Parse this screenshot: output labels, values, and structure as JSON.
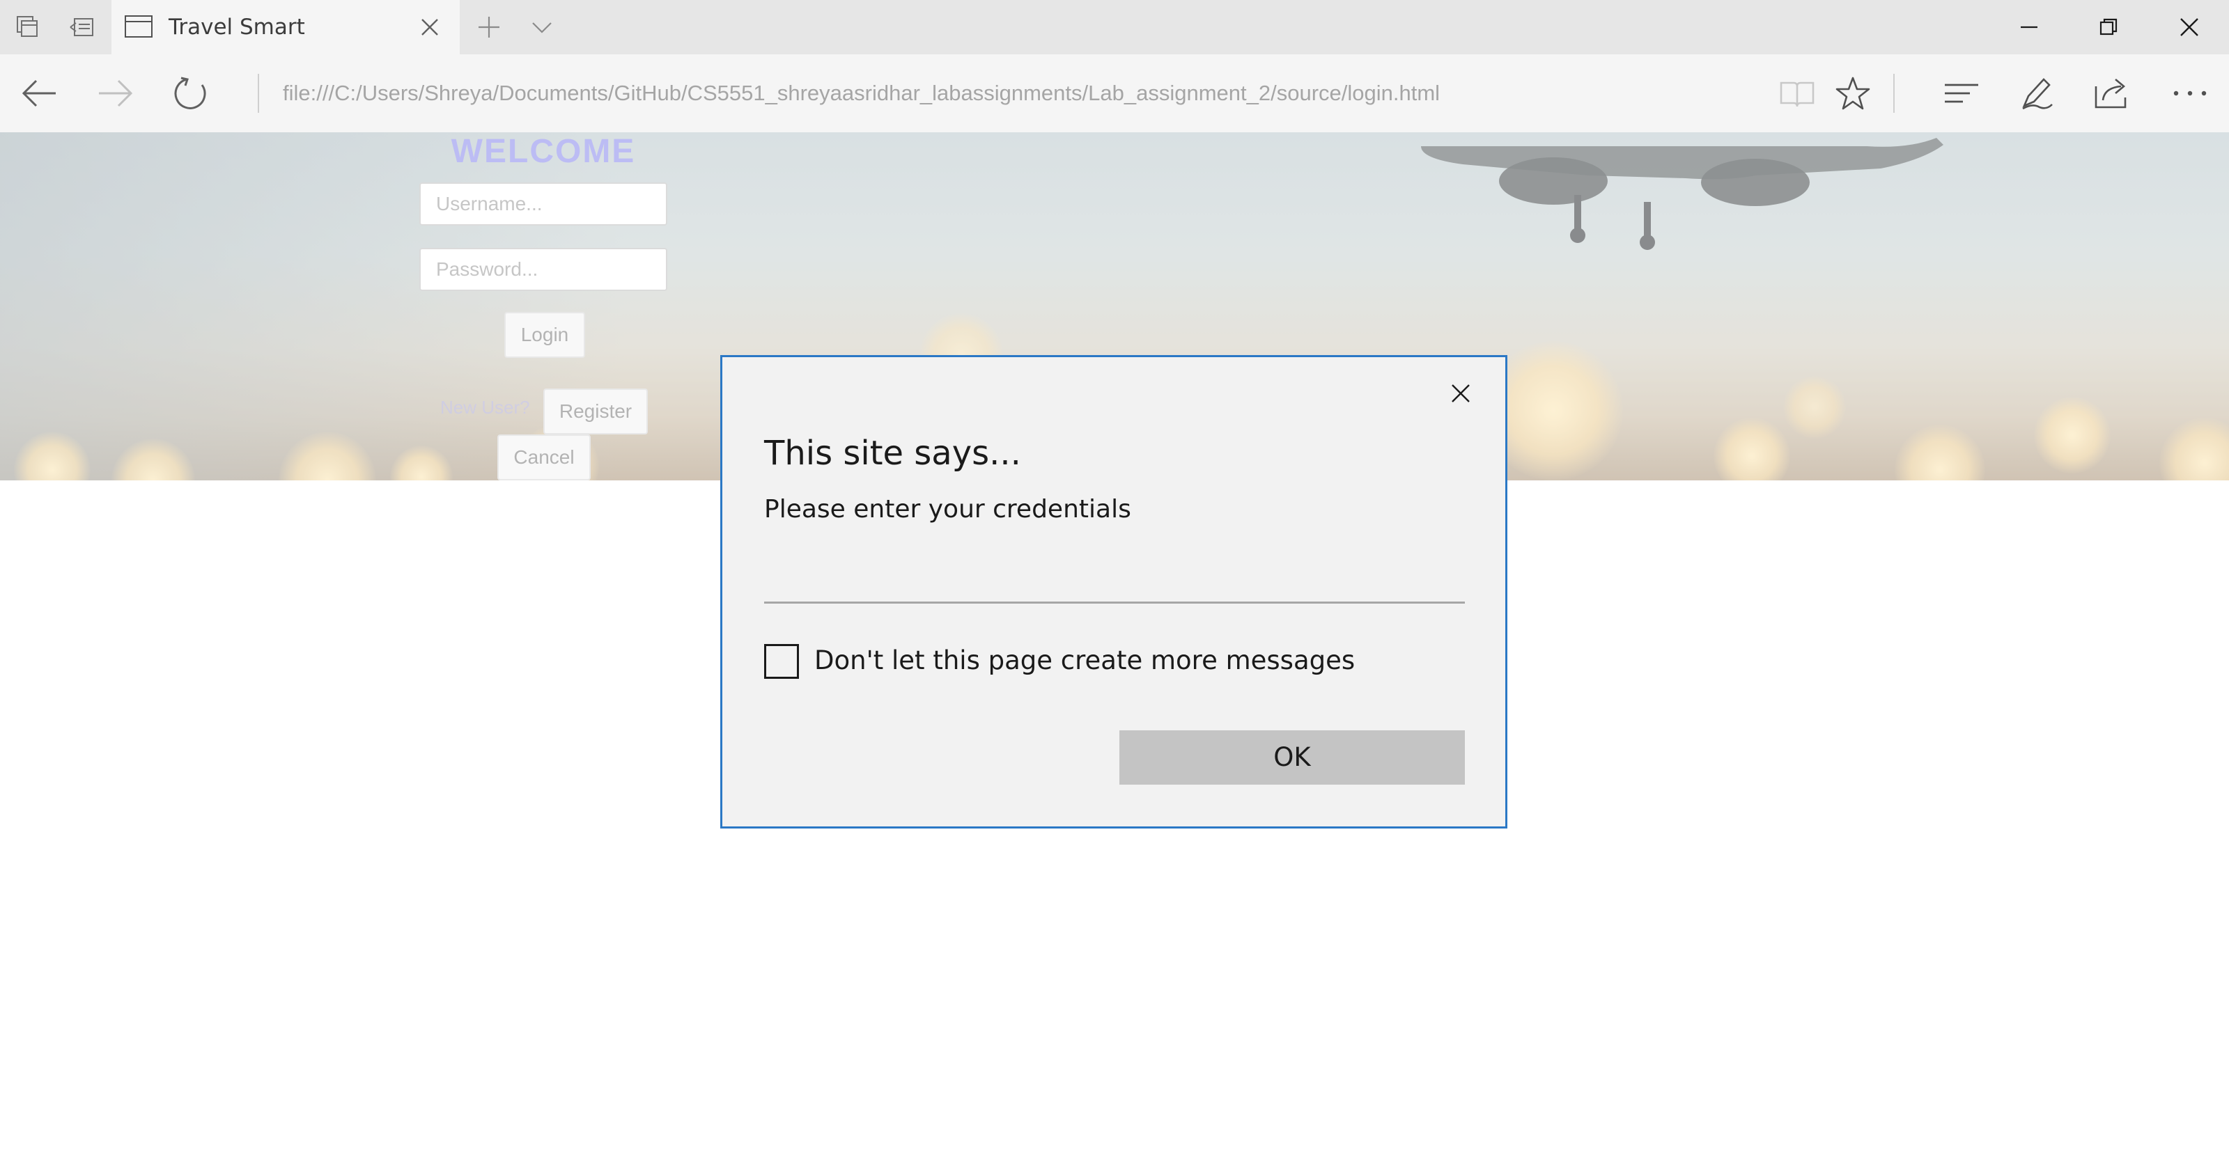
{
  "browser": {
    "tab": {
      "title": "Travel Smart"
    },
    "address_bar": {
      "url": "file:///C:/Users/Shreya/Documents/GitHub/CS5551_shreyaasridhar_labassignments/Lab_assignment_2/source/login.html"
    },
    "window_controls": [
      "minimize",
      "restore",
      "close"
    ]
  },
  "page": {
    "welcome": "WELCOME",
    "username_placeholder": "Username...",
    "password_placeholder": "Password...",
    "login_label": "Login",
    "new_user_label": "New User?",
    "register_label": "Register",
    "cancel_label": "Cancel"
  },
  "dialog": {
    "title": "This site says...",
    "message": "Please enter your credentials",
    "input_value": "",
    "checkbox_label": "Don't let this page create more messages",
    "checkbox_checked": false,
    "ok_label": "OK"
  },
  "colors": {
    "dialog_border": "#2b78c5",
    "welcome": "#9999ee",
    "ok_button": "#c4c4c4"
  },
  "icons": [
    "tab-manager-icon",
    "set-aside-tabs-icon",
    "tab-page-icon",
    "close-tab-icon",
    "new-tab-icon",
    "tab-list-chevron-icon",
    "back-arrow-icon",
    "forward-arrow-icon",
    "refresh-icon",
    "reading-view-icon",
    "favorite-star-icon",
    "hub-icon",
    "web-note-icon",
    "share-icon",
    "more-icon",
    "dialog-close-icon"
  ]
}
